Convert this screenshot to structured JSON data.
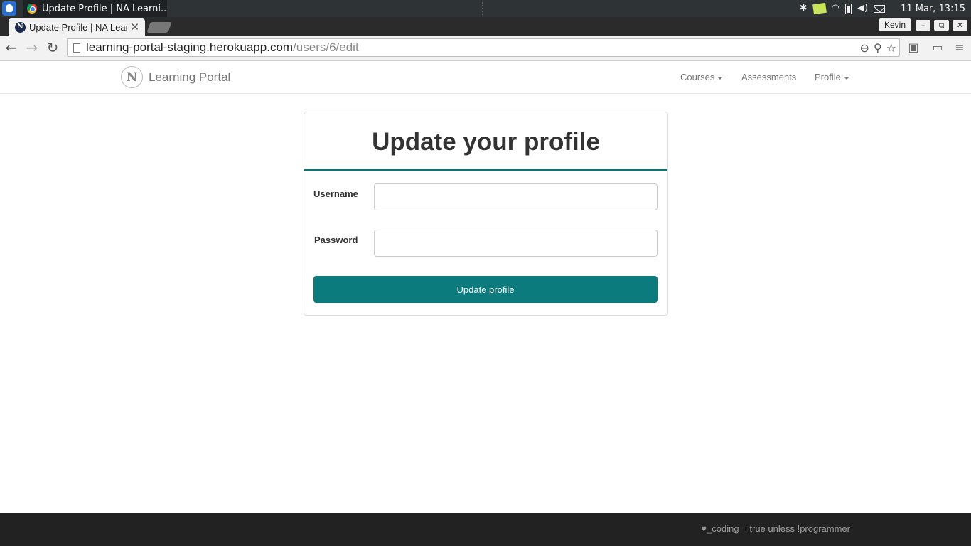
{
  "os": {
    "task_title": "Update Profile | NA Learni...",
    "clock": "11 Mar, 13:15"
  },
  "browser": {
    "tab_title": "Update Profile | NA Learning Portal",
    "tab_favicon": "N",
    "profile_name": "Kevin",
    "url_host": "learning-portal-staging.herokuapp.com",
    "url_path": "/users/6/edit"
  },
  "navbar": {
    "brand_logo": "N",
    "brand_name": "Learning Portal",
    "links": {
      "courses": "Courses",
      "assessments": "Assessments",
      "profile": "Profile"
    }
  },
  "form": {
    "title": "Update your profile",
    "username_label": "Username",
    "username_value": "",
    "password_label": "Password",
    "password_value": "",
    "submit_label": "Update profile",
    "accent_color": "#0b7b7e"
  },
  "footer": {
    "text": "♥_coding = true unless !programmer"
  }
}
